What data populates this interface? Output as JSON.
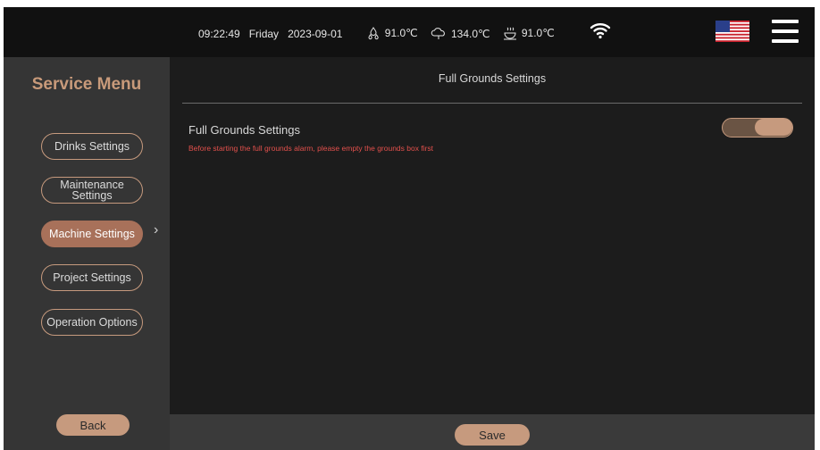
{
  "status": {
    "time": "09:22:49",
    "weekday": "Friday",
    "date": "2023-09-01",
    "temp1": "91.0℃",
    "temp2": "134.0℃",
    "temp3": "91.0℃"
  },
  "sidebar": {
    "title": "Service Menu",
    "items": [
      {
        "label": "Drinks Settings"
      },
      {
        "label": "Maintenance Settings"
      },
      {
        "label": "Machine Settings"
      },
      {
        "label": "Project Settings"
      },
      {
        "label": "Operation Options"
      }
    ],
    "back_label": "Back"
  },
  "content": {
    "title": "Full Grounds Settings",
    "setting_label": "Full Grounds Settings",
    "warning": "Before starting the full grounds alarm, please empty the grounds box first",
    "toggle_on": true
  },
  "footer": {
    "save_label": "Save"
  },
  "colors": {
    "accent": "#c69a7e",
    "active_nav": "#a8715a",
    "warning": "#e2504c"
  }
}
